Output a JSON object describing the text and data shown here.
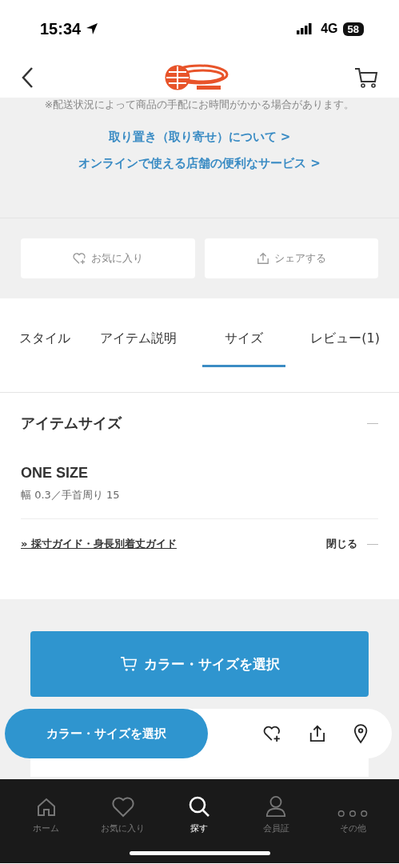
{
  "status_bar": {
    "time": "15:34",
    "network": "4G",
    "battery": "58"
  },
  "notice": "※配送状況によって商品の手配にお時間がかかる場合があります。",
  "links": [
    {
      "label": "取り置き（取り寄せ）について",
      "arrow": ">"
    },
    {
      "label": "オンラインで使える店舗の便利なサービス",
      "arrow": ">"
    }
  ],
  "action_buttons": [
    {
      "kind": "favorite",
      "label": "お気に入り"
    },
    {
      "kind": "share",
      "label": "シェアする"
    }
  ],
  "tabs": [
    {
      "label": "スタイル",
      "selected": false
    },
    {
      "label": "アイテム説明",
      "selected": false
    },
    {
      "label": "サイズ",
      "selected": true
    },
    {
      "label": "レビュー(1)",
      "selected": false
    }
  ],
  "size_section": {
    "title": "アイテムサイズ",
    "expanded": true,
    "size_name": "ONE SIZE",
    "measurements": "幅 0.3／手首周り 15",
    "guide_link": "» 採寸ガイド・身長別着丈ガイド",
    "close_label": "閉じる"
  },
  "select_button": "カラー・サイズを選択",
  "floating_bar": {
    "button": "カラー・サイズを選択"
  },
  "bottom_nav": [
    {
      "kind": "home",
      "label": "ホーム",
      "selected": false
    },
    {
      "kind": "heart",
      "label": "お気に入り",
      "selected": false
    },
    {
      "kind": "search",
      "label": "探す",
      "selected": true
    },
    {
      "kind": "person",
      "label": "会員証",
      "selected": false
    },
    {
      "kind": "more",
      "label": "その他",
      "selected": false
    }
  ]
}
